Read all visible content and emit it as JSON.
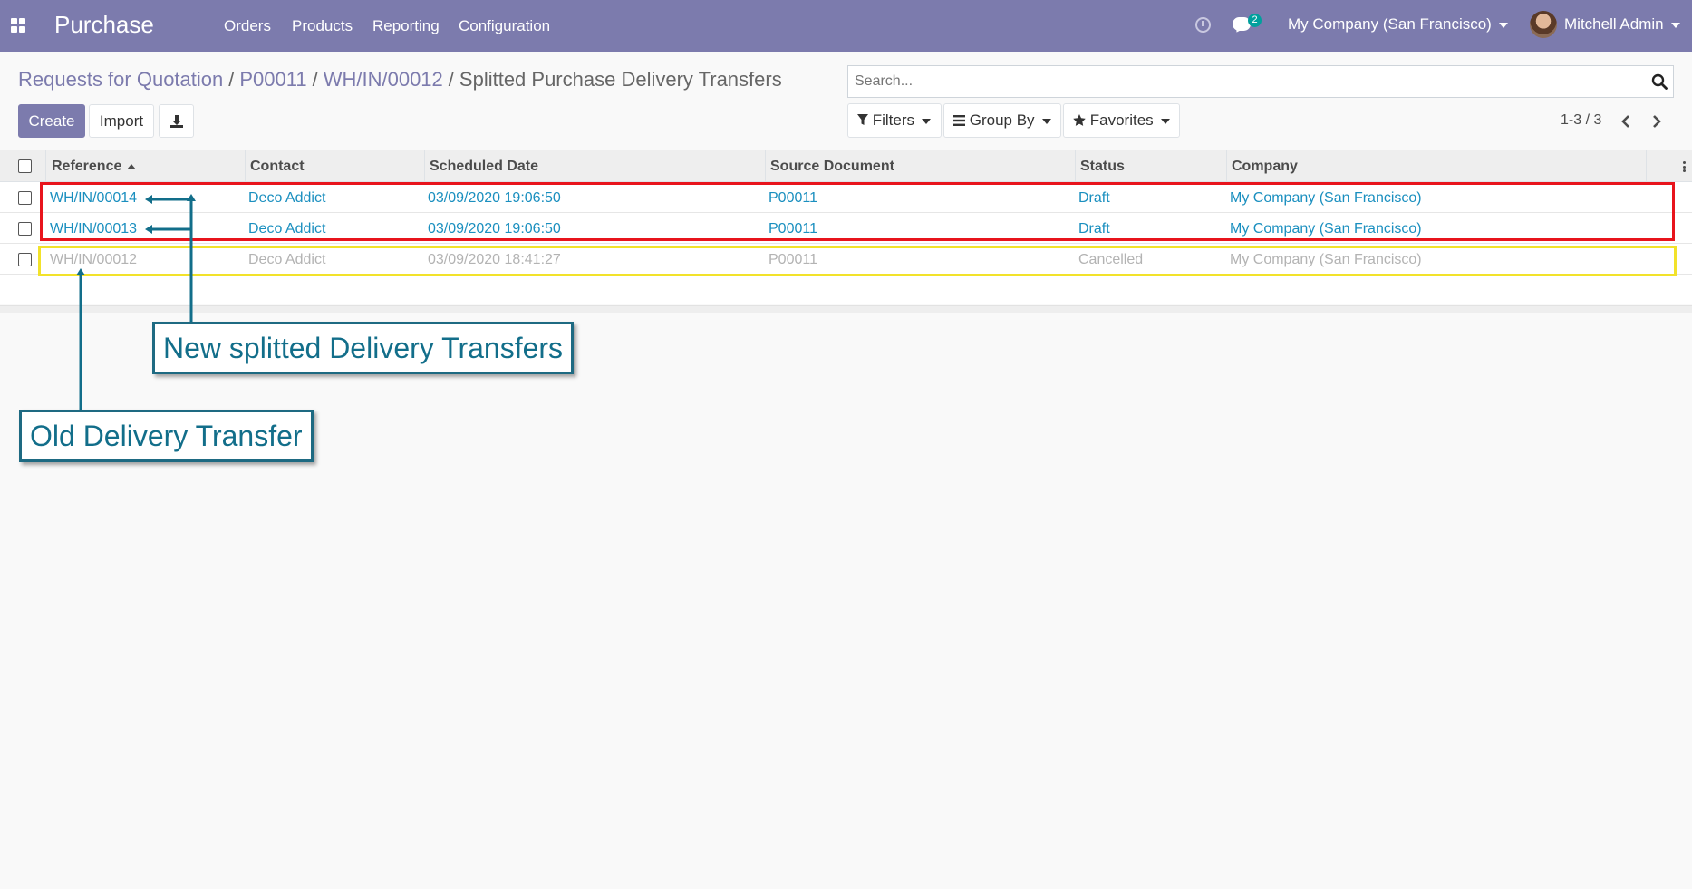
{
  "navbar": {
    "brand": "Purchase",
    "menu": [
      "Orders",
      "Products",
      "Reporting",
      "Configuration"
    ],
    "messages_count": "2",
    "company": "My Company (San Francisco)",
    "user": "Mitchell Admin",
    "bg_color": "#7c7bad"
  },
  "breadcrumb": {
    "items": [
      "Requests for Quotation",
      "P00011",
      "WH/IN/00012"
    ],
    "current": "Splitted Purchase Delivery Transfers"
  },
  "buttons": {
    "create": "Create",
    "import": "Import",
    "download_icon": "download-icon"
  },
  "search": {
    "placeholder": "Search..."
  },
  "filters": {
    "filters": "Filters",
    "group_by": "Group By",
    "favorites": "Favorites"
  },
  "pager": {
    "text": "1-3 / 3"
  },
  "table": {
    "columns": [
      "Reference",
      "Contact",
      "Scheduled Date",
      "Source Document",
      "Status",
      "Company"
    ],
    "rows": [
      {
        "reference": "WH/IN/00014",
        "contact": "Deco Addict",
        "date": "03/09/2020 19:06:50",
        "source": "P00011",
        "status": "Draft",
        "company": "My Company (San Francisco)"
      },
      {
        "reference": "WH/IN/00013",
        "contact": "Deco Addict",
        "date": "03/09/2020 19:06:50",
        "source": "P00011",
        "status": "Draft",
        "company": "My Company (San Francisco)"
      },
      {
        "reference": "WH/IN/00012",
        "contact": "Deco Addict",
        "date": "03/09/2020 18:41:27",
        "source": "P00011",
        "status": "Cancelled",
        "company": "My Company (San Francisco)"
      }
    ]
  },
  "annotations": {
    "new": "New splitted Delivery Transfers",
    "old": "Old Delivery Transfer",
    "new_box_color": "#e8141c",
    "old_box_color": "#f2e22a",
    "callout_color": "#1e6a82"
  }
}
